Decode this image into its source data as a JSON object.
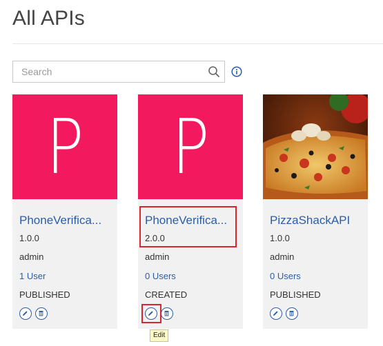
{
  "page": {
    "title": "All APIs"
  },
  "search": {
    "placeholder": "Search",
    "value": ""
  },
  "apis": [
    {
      "name": "PhoneVerifica...",
      "version": "1.0.0",
      "owner": "admin",
      "users": "1 User",
      "status": "PUBLISHED",
      "thumbnail_letter": "P",
      "thumbnail_color": "#f3195f"
    },
    {
      "name": "PhoneVerifica...",
      "version": "2.0.0",
      "owner": "admin",
      "users": "0 Users",
      "status": "CREATED",
      "thumbnail_letter": "P",
      "thumbnail_color": "#f3195f"
    },
    {
      "name": "PizzaShackAPI",
      "version": "1.0.0",
      "owner": "admin",
      "users": "0 Users",
      "status": "PUBLISHED",
      "thumbnail_image": "pizza-photo"
    }
  ],
  "tooltip": {
    "text": "Edit"
  },
  "colors": {
    "accent": "#2a5da8",
    "thumbnail": "#f3195f",
    "highlight": "#d9252d"
  }
}
